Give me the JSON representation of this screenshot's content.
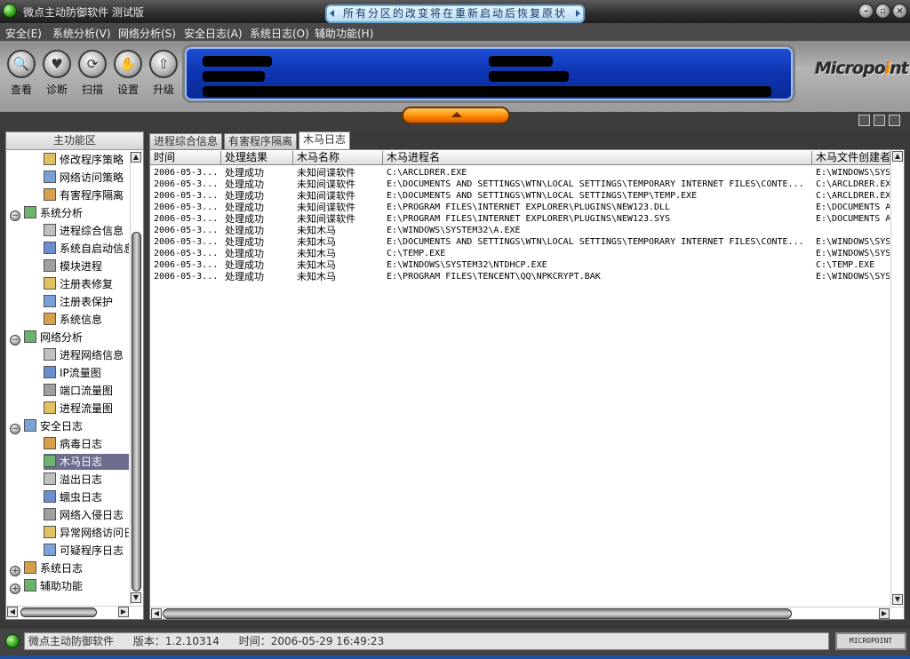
{
  "window": {
    "title": "微点主动防御软件  测试版",
    "notice": "所有分区的改变将在重新启动后恢复原状",
    "minimize": "–",
    "maximize": "▫",
    "close": "×"
  },
  "menu": [
    "安全(E)",
    "系统分析(V)",
    "网络分析(S)",
    "安全日志(A)",
    "系统日志(O)",
    "辅助功能(H)"
  ],
  "toolbar": {
    "buttons": [
      {
        "label": "查看",
        "icon": "magnifier-icon",
        "glyph": "🔍"
      },
      {
        "label": "诊断",
        "icon": "heart-icon",
        "glyph": "♥"
      },
      {
        "label": "扫描",
        "icon": "scan-icon",
        "glyph": "⟳"
      },
      {
        "label": "设置",
        "icon": "hand-icon",
        "glyph": "✋"
      },
      {
        "label": "升级",
        "icon": "upgrade-icon",
        "glyph": "⇧"
      }
    ],
    "logo_text_a": "Micropo",
    "logo_text_b": "i",
    "logo_text_c": "nt"
  },
  "colors": {
    "accent": "#0d34b0",
    "selection": "#6c6c8c",
    "handle": "#ff8a00"
  },
  "left_panel": {
    "header": "主功能区",
    "tree": [
      {
        "label": "修改程序策略",
        "level": 1,
        "icon": "policy-icon"
      },
      {
        "label": "网络访问策略",
        "level": 1,
        "icon": "network-policy-icon"
      },
      {
        "label": "有害程序隔离",
        "level": 1,
        "icon": "quarantine-icon"
      },
      {
        "label": "系统分析",
        "level": 0,
        "icon": "system-analysis-icon",
        "expander": "−"
      },
      {
        "label": "进程综合信息",
        "level": 1,
        "icon": "process-info-icon"
      },
      {
        "label": "系统自启动信息",
        "level": 1,
        "icon": "autostart-icon"
      },
      {
        "label": "模块进程",
        "level": 1,
        "icon": "module-icon"
      },
      {
        "label": "注册表修复",
        "level": 1,
        "icon": "registry-repair-icon"
      },
      {
        "label": "注册表保护",
        "level": 1,
        "icon": "registry-protect-icon"
      },
      {
        "label": "系统信息",
        "level": 1,
        "icon": "system-info-icon"
      },
      {
        "label": "网络分析",
        "level": 0,
        "icon": "network-analysis-icon",
        "expander": "−"
      },
      {
        "label": "进程网络信息",
        "level": 1,
        "icon": "process-network-icon"
      },
      {
        "label": "IP流量图",
        "level": 1,
        "icon": "ip-traffic-icon"
      },
      {
        "label": "端口流量图",
        "level": 1,
        "icon": "port-traffic-icon"
      },
      {
        "label": "进程流量图",
        "level": 1,
        "icon": "process-traffic-icon"
      },
      {
        "label": "安全日志",
        "level": 0,
        "icon": "security-log-icon",
        "expander": "−"
      },
      {
        "label": "病毒日志",
        "level": 1,
        "icon": "virus-icon"
      },
      {
        "label": "木马日志",
        "level": 1,
        "icon": "trojan-icon",
        "selected": true
      },
      {
        "label": "溢出日志",
        "level": 1,
        "icon": "overflow-icon"
      },
      {
        "label": "蠕虫日志",
        "level": 1,
        "icon": "worm-icon"
      },
      {
        "label": "网络入侵日志",
        "level": 1,
        "icon": "intrusion-icon"
      },
      {
        "label": "异常网络访问日志",
        "level": 1,
        "icon": "abnormal-access-icon"
      },
      {
        "label": "可疑程序日志",
        "level": 1,
        "icon": "suspicious-icon"
      },
      {
        "label": "系统日志",
        "level": 0,
        "icon": "system-log-icon",
        "expander": "+"
      },
      {
        "label": "辅助功能",
        "level": 0,
        "icon": "aux-icon",
        "expander": "+"
      }
    ]
  },
  "tabs": [
    "进程综合信息",
    "有害程序隔离",
    "木马日志"
  ],
  "table": {
    "columns": [
      "时间",
      "处理结果",
      "木马名称",
      "木马进程名",
      "木马文件创建者"
    ],
    "rows": [
      [
        "2006-05-3...",
        "处理成功",
        "未知间谍软件",
        "C:\\ARCLDRER.EXE",
        "E:\\WINDOWS\\SYS"
      ],
      [
        "2006-05-3...",
        "处理成功",
        "未知间谍软件",
        "E:\\DOCUMENTS AND SETTINGS\\WTN\\LOCAL SETTINGS\\TEMPORARY INTERNET FILES\\CONTE...",
        "C:\\ARCLDRER.EX"
      ],
      [
        "2006-05-3...",
        "处理成功",
        "未知间谍软件",
        "E:\\DOCUMENTS AND SETTINGS\\WTN\\LOCAL SETTINGS\\TEMP\\TEMP.EXE",
        "C:\\ARCLDRER.EX"
      ],
      [
        "2006-05-3...",
        "处理成功",
        "未知间谍软件",
        "E:\\PROGRAM FILES\\INTERNET EXPLORER\\PLUGINS\\NEW123.DLL",
        "E:\\DOCUMENTS A"
      ],
      [
        "2006-05-3...",
        "处理成功",
        "未知间谍软件",
        "E:\\PROGRAM FILES\\INTERNET EXPLORER\\PLUGINS\\NEW123.SYS",
        "E:\\DOCUMENTS A"
      ],
      [
        "2006-05-3...",
        "处理成功",
        "未知木马",
        "E:\\WINDOWS\\SYSTEM32\\A.EXE",
        ""
      ],
      [
        "2006-05-3...",
        "处理成功",
        "未知木马",
        "E:\\DOCUMENTS AND SETTINGS\\WTN\\LOCAL SETTINGS\\TEMPORARY INTERNET FILES\\CONTE...",
        "E:\\WINDOWS\\SYS"
      ],
      [
        "2006-05-3...",
        "处理成功",
        "未知木马",
        "C:\\TEMP.EXE",
        "E:\\WINDOWS\\SYS"
      ],
      [
        "2006-05-3...",
        "处理成功",
        "未知木马",
        "E:\\WINDOWS\\SYSTEM32\\NTDHCP.EXE",
        "C:\\TEMP.EXE"
      ],
      [
        "2006-05-3...",
        "处理成功",
        "未知木马",
        "E:\\PROGRAM FILES\\TENCENT\\QQ\\NPKCRYPT.BAK",
        "E:\\WINDOWS\\SYS"
      ]
    ]
  },
  "status": {
    "app_name": "微点主动防御软件",
    "version": "版本：1.2.10314",
    "time": "时间：2006-05-29 16:49:23",
    "brand": "MICROPOINT"
  }
}
